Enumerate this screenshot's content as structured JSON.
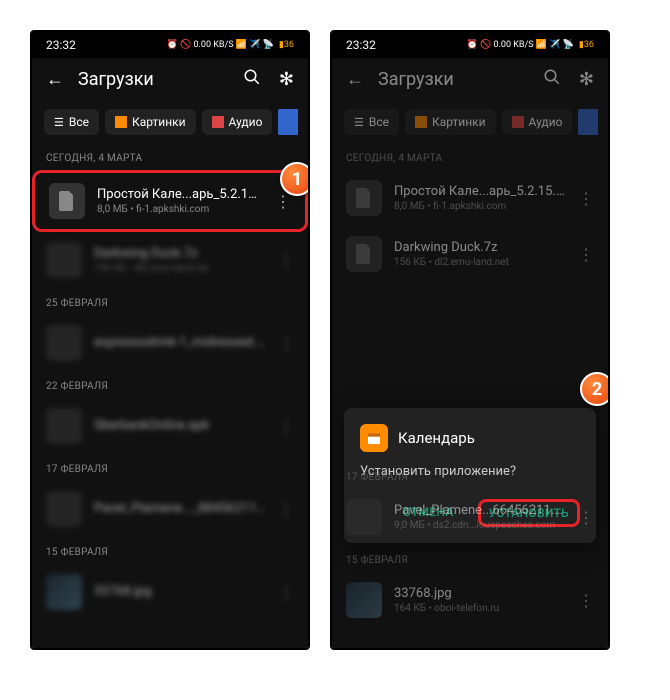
{
  "status": {
    "time": "23:32",
    "icons": "⏰ 🚫 0.00 KB/S 📶 ✈️ 📡",
    "battery": "36"
  },
  "header": {
    "title": "Загрузки"
  },
  "chips": {
    "all": "Все",
    "images": "Картинки",
    "audio": "Аудио"
  },
  "callouts": {
    "one": "1",
    "two": "2"
  },
  "screen1": {
    "sections": [
      {
        "label": "СЕГОДНЯ, 4 МАРТА",
        "files": [
          {
            "name": "Простой Кале...арь_5.2.15.apk",
            "meta": "8,0 МБ • fi-1.apkshki.com",
            "highlighted": true
          },
          {
            "name": "Darkwing Duck.7z",
            "meta": "156 КБ • dl2.emu-land.net",
            "blurred": true
          }
        ]
      },
      {
        "label": "25 ФЕВРАЛЯ",
        "files": [
          {
            "name": "espressodrink-1_midressed.ru.apk",
            "meta": "",
            "blurred": true
          }
        ]
      },
      {
        "label": "22 ФЕВРАЛЯ",
        "files": [
          {
            "name": "SberbankOnline.apk",
            "meta": "",
            "blurred": true
          }
        ]
      },
      {
        "label": "17 ФЕВРАЛЯ",
        "files": [
          {
            "name": "Pavel_Plamene..._88456211.mp3",
            "meta": "",
            "blurred": true
          }
        ]
      },
      {
        "label": "15 ФЕВРАЛЯ",
        "files": [
          {
            "name": "33768.jpg",
            "meta": "",
            "blurred": true
          }
        ]
      }
    ]
  },
  "screen2": {
    "sections": [
      {
        "label": "СЕГОДНЯ, 4 МАРТА",
        "files": [
          {
            "name": "Простой Кале...арь_5.2.15.apk",
            "meta": "8,0 МБ • fi-1.apkshki.com"
          },
          {
            "name": "Darkwing Duck.7z",
            "meta": "156 КБ • dl2.emu-land.net"
          }
        ]
      },
      {
        "label": "17 ФЕВРАЛЯ",
        "files": [
          {
            "name": "Pavel_Plamene...66456211.mp3",
            "meta": "9,0 МБ • ds2.cdn...iouspeaches.com"
          }
        ]
      },
      {
        "label": "15 ФЕВРАЛЯ",
        "files": [
          {
            "name": "33768.jpg",
            "meta": "164 КБ • oboi-telefon.ru"
          }
        ]
      }
    ],
    "dialog": {
      "title": "Календарь",
      "text": "Установить приложение?",
      "cancel": "ОТМЕНА",
      "install": "УСТАНОВИТЬ"
    }
  }
}
